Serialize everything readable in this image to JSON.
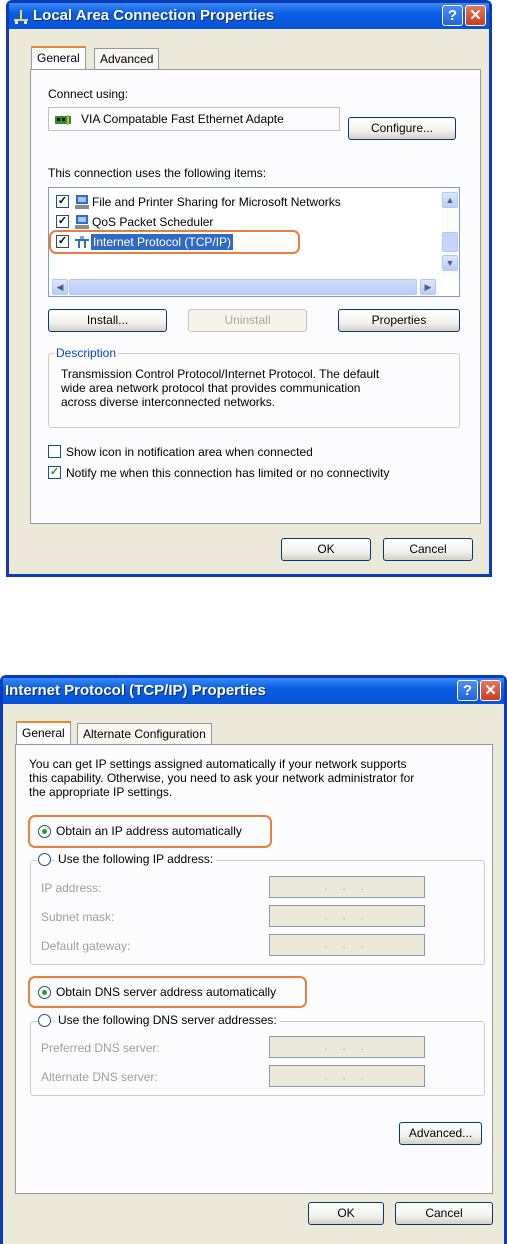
{
  "lan_dialog": {
    "title": "Local Area Connection Properties",
    "tabs": [
      "General",
      "Advanced"
    ],
    "connect_using_label": "Connect using:",
    "adapter_name": "VIA Compatable Fast Ethernet Adapte",
    "configure_button": "Configure...",
    "items_label": "This connection uses the following items:",
    "items": [
      {
        "label": "File and Printer Sharing for Microsoft Networks",
        "checked": true,
        "icon": "network-service-icon"
      },
      {
        "label": "QoS Packet Scheduler",
        "checked": true,
        "icon": "network-service-icon"
      },
      {
        "label": "Internet Protocol (TCP/IP)",
        "checked": true,
        "icon": "protocol-icon",
        "selected": true,
        "highlighted": true
      }
    ],
    "install_button": "Install...",
    "uninstall_button": "Uninstall",
    "properties_button": "Properties",
    "description_label": "Description",
    "description_lines": [
      "Transmission Control Protocol/Internet Protocol. The default",
      "wide area network protocol that provides communication",
      "across diverse interconnected networks."
    ],
    "show_icon_label": "Show icon in notification area when connected",
    "show_icon_checked": false,
    "notify_label": "Notify me when this connection has limited or no connectivity",
    "notify_checked": true,
    "ok_button": "OK",
    "cancel_button": "Cancel"
  },
  "tcpip_dialog": {
    "title": "Internet Protocol (TCP/IP) Properties",
    "tabs": [
      "General",
      "Alternate Configuration"
    ],
    "intro_lines": [
      "You can get IP settings assigned automatically if your network supports",
      "this capability. Otherwise, you need to ask your network administrator for",
      "the appropriate IP settings."
    ],
    "obtain_ip_label": "Obtain an IP address automatically",
    "obtain_ip_selected": true,
    "use_ip_label": "Use the following IP address:",
    "ip_address_label": "IP address:",
    "subnet_mask_label": "Subnet mask:",
    "default_gateway_label": "Default gateway:",
    "ip_field_placeholder": ". . .",
    "obtain_dns_label": "Obtain DNS server address automatically",
    "obtain_dns_selected": true,
    "use_dns_label": "Use the following DNS server addresses:",
    "preferred_dns_label": "Preferred DNS server:",
    "alternate_dns_label": "Alternate DNS server:",
    "advanced_button": "Advanced...",
    "ok_button": "OK",
    "cancel_button": "Cancel"
  },
  "colors": {
    "title_bar": "#0654d8",
    "highlight": "#f07c3c",
    "selection": "#316ac5",
    "dialog_bg": "#ece9d8"
  }
}
